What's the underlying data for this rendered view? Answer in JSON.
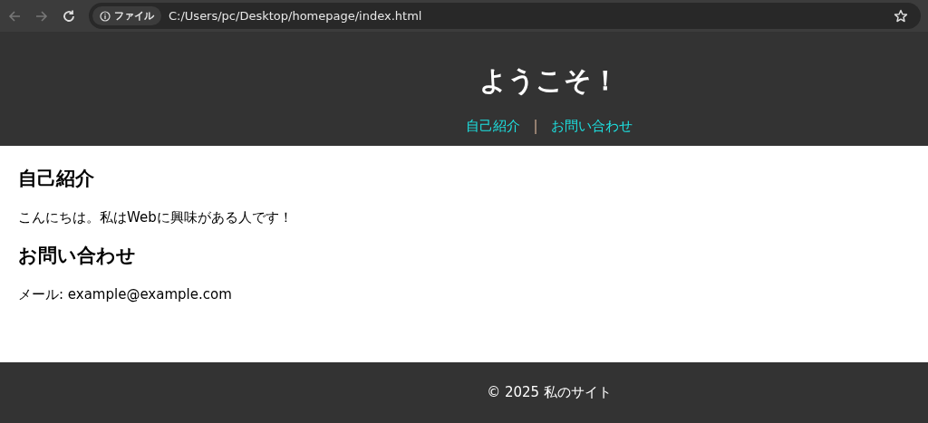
{
  "browser": {
    "security_label": "ファイル",
    "address": "C:/Users/pc/Desktop/homepage/index.html"
  },
  "header": {
    "title": "ようこそ！",
    "nav": [
      {
        "kind": "link",
        "text": "自己紹介"
      },
      {
        "kind": "separator",
        "text": "|"
      },
      {
        "kind": "link",
        "text": "お問い合わせ"
      }
    ]
  },
  "sections": [
    {
      "heading": "自己紹介",
      "text": "こんにちは。私はWebに興味がある人です！"
    },
    {
      "heading": "お問い合わせ",
      "text": "メール: example@example.com"
    }
  ],
  "footer": {
    "text": "© 2025 私のサイト"
  }
}
